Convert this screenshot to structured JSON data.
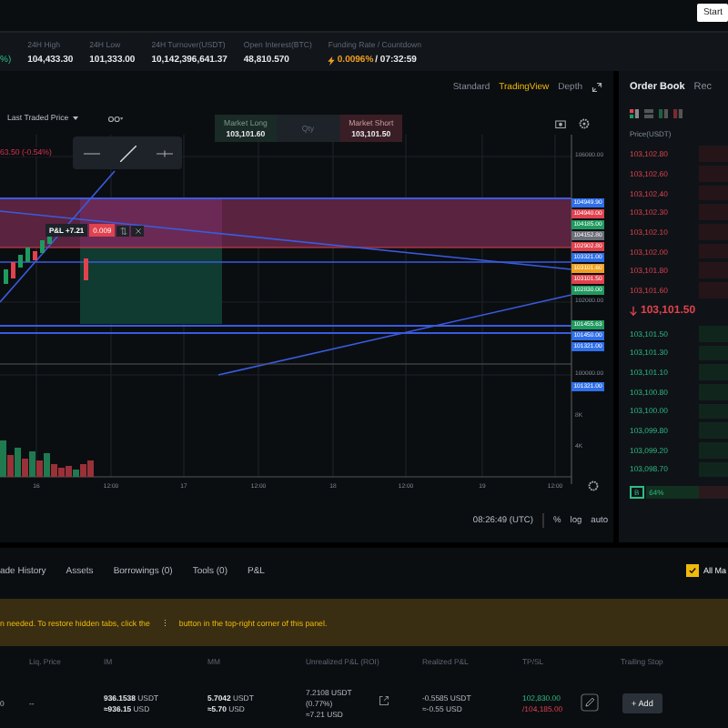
{
  "header": {
    "start_button": "Start"
  },
  "stats": {
    "change_fragment": "%)",
    "items": [
      {
        "label": "24H High",
        "value": "104,433.30"
      },
      {
        "label": "24H Low",
        "value": "101,333.00"
      },
      {
        "label": "24H Turnover(USDT)",
        "value": "10,142,396,641.37"
      },
      {
        "label": "Open Interest(BTC)",
        "value": "48,810.570"
      }
    ],
    "funding": {
      "label": "Funding Rate / Countdown",
      "rate": "0.0096%",
      "countdown": "/ 07:32:59"
    }
  },
  "chart_tabs": [
    {
      "label": "Standard",
      "selected": false
    },
    {
      "label": "TradingView",
      "selected": true
    },
    {
      "label": "Depth",
      "selected": false
    }
  ],
  "chart": {
    "price_source": "Last Traded Price",
    "change": "63.50 (-0.54%)",
    "market_long": {
      "label": "Market Long",
      "price": "103,101.60"
    },
    "qty_label": "Qty",
    "market_short": {
      "label": "Market Short",
      "price": "103,101.50"
    },
    "pnl_tag": {
      "label": "P&L",
      "value": "+7.21",
      "qty": "0.009"
    },
    "price_labels": [
      {
        "text": "104949.90",
        "color": "#2f6fe8"
      },
      {
        "text": "104940.00",
        "color": "#e0424e"
      },
      {
        "text": "104185.00",
        "color": "#1f9a5f"
      },
      {
        "text": "104152.80",
        "color": "#6b6f78"
      },
      {
        "text": "102902.80",
        "color": "#e0424e"
      },
      {
        "text": "103321.00",
        "color": "#2f6fe8"
      },
      {
        "text": "103101.60",
        "color": "#f0a020"
      },
      {
        "text": "103101.50",
        "color": "#e0424e"
      },
      {
        "text": "102830.00",
        "color": "#1f9a5f"
      },
      {
        "text": "101455.63",
        "color": "#1f9a5f"
      },
      {
        "text": "101450.00",
        "color": "#2f6fe8"
      },
      {
        "text": "101321.00",
        "color": "#2f6fe8"
      },
      {
        "text": "101321.00",
        "color": "#2f6fe8"
      }
    ],
    "axis_labels": [
      "106000.00",
      "102000.00",
      "100000.00"
    ],
    "volume_labels": [
      "8K",
      "4K"
    ],
    "time_labels": [
      "16",
      "12:00",
      "17",
      "12:00",
      "18",
      "12:00",
      "19",
      "12:00"
    ]
  },
  "chart_footer": {
    "time": "08:26:49 (UTC)",
    "buttons": [
      "%",
      "log",
      "auto"
    ]
  },
  "order_book": {
    "tabs": [
      {
        "label": "Order Book",
        "selected": true
      },
      {
        "label": "Rec",
        "selected": false
      }
    ],
    "column": "Price(USDT)",
    "asks": [
      "103,102.80",
      "103,102.60",
      "103,102.40",
      "103,102.30",
      "103,102.10",
      "103,102.00",
      "103,101.80",
      "103,101.60"
    ],
    "last_price": "103,101.50",
    "bids": [
      "103,101.50",
      "103,101.30",
      "103,101.10",
      "103,100.80",
      "103,100.00",
      "103,099.80",
      "103,099.20",
      "103,098.70"
    ],
    "buy_label": "B",
    "buy_ratio": "64%",
    "level": 0.64
  },
  "bottom_tabs": [
    {
      "label": "ade History",
      "selected": false
    },
    {
      "label": "Assets",
      "selected": false
    },
    {
      "label": "Borrowings (0)",
      "selected": false
    },
    {
      "label": "Tools (0)",
      "selected": false
    },
    {
      "label": "P&L",
      "selected": false
    }
  ],
  "all_markets": {
    "label": "All Ma",
    "checked": true
  },
  "notice": {
    "before": "n needed. To restore hidden tabs, click the",
    "icon": "⋮",
    "after": "button in the top-right corner of this panel."
  },
  "positions": {
    "columns": [
      "Liq. Price",
      "IM",
      "MM",
      "Unrealized P&L (ROI)",
      "Realized P&L",
      "TP/SL",
      "Trailing Stop"
    ],
    "row": {
      "cell_0": "0",
      "liq_price": "--",
      "im": {
        "amount": "936.1538",
        "unit": "USDT",
        "approx": "≈936.15",
        "approx_unit": "USD"
      },
      "mm": {
        "amount": "5.7042",
        "unit": "USDT",
        "approx": "≈5.70",
        "approx_unit": "USD"
      },
      "unrealized": [
        "7.2108 USDT",
        "(0.77%)",
        "≈7.21 USD"
      ],
      "realized": [
        "-0.5585 USDT",
        "≈-0.55 USD"
      ],
      "tp": "102,830.00",
      "sl": "/104,185.00",
      "trailing_button": "+ Add"
    }
  }
}
